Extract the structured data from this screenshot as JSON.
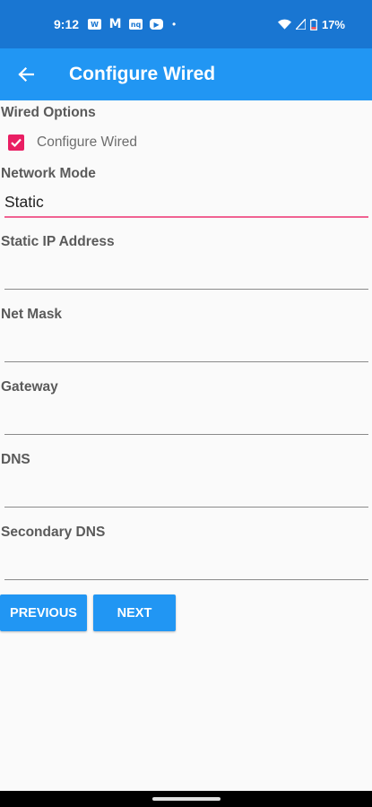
{
  "status_bar": {
    "time": "9:12",
    "notifications": [
      "W",
      "M",
      "nq",
      "▶"
    ],
    "battery": "17%"
  },
  "app_bar": {
    "title": "Configure Wired"
  },
  "form": {
    "wired_options_label": "Wired Options",
    "configure_wired_label": "Configure Wired",
    "configure_wired_checked": true,
    "network_mode_label": "Network Mode",
    "network_mode_value": "Static",
    "static_ip_label": "Static IP Address",
    "static_ip_value": "",
    "net_mask_label": "Net Mask",
    "net_mask_value": "",
    "gateway_label": "Gateway",
    "gateway_value": "",
    "dns_label": "DNS",
    "dns_value": "",
    "secondary_dns_label": "Secondary DNS",
    "secondary_dns_value": ""
  },
  "buttons": {
    "previous": "PREVIOUS",
    "next": "NEXT"
  },
  "colors": {
    "status_bar": "#1976d2",
    "app_bar": "#2196f3",
    "accent": "#e91e63"
  }
}
